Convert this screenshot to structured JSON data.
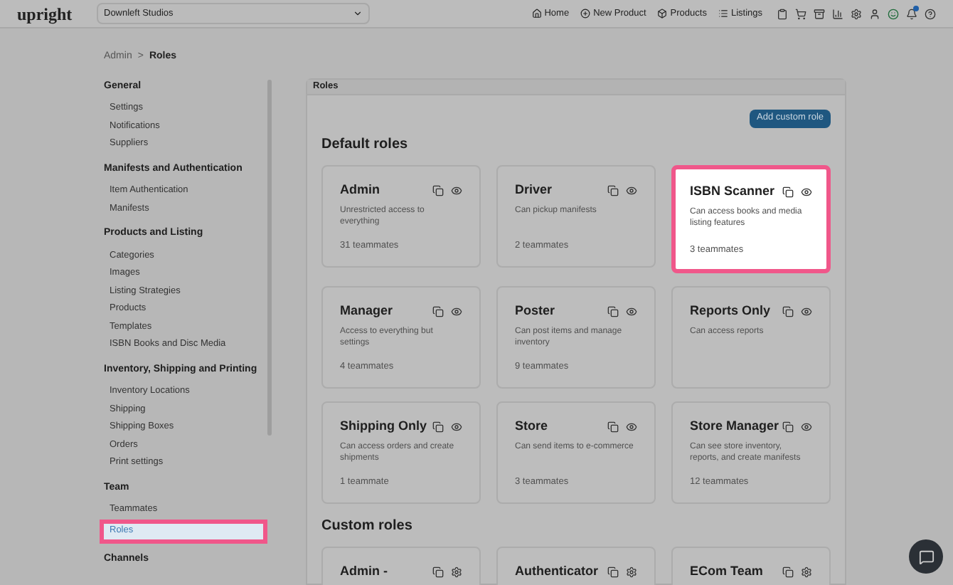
{
  "topbar": {
    "logo": "upright",
    "org_select": "Downleft Studios",
    "nav": [
      {
        "label": "Home"
      },
      {
        "label": "New Product"
      },
      {
        "label": "Products"
      },
      {
        "label": "Listings"
      }
    ],
    "notification_dot": true
  },
  "breadcrumb": {
    "parent": "Admin",
    "separator": ">",
    "current": "Roles"
  },
  "sidebar": [
    {
      "title": "General",
      "items": [
        {
          "label": "Settings",
          "highlighted": false
        },
        {
          "label": "Notifications",
          "highlighted": false
        },
        {
          "label": "Suppliers",
          "highlighted": false
        }
      ]
    },
    {
      "title": "Manifests and Authentication",
      "items": [
        {
          "label": "Item Authentication",
          "highlighted": false
        },
        {
          "label": "Manifests",
          "highlighted": false
        }
      ]
    },
    {
      "title": "Products and Listing",
      "items": [
        {
          "label": "Categories",
          "highlighted": false
        },
        {
          "label": "Images",
          "highlighted": false
        },
        {
          "label": "Listing Strategies",
          "highlighted": false
        },
        {
          "label": "Products",
          "highlighted": false
        },
        {
          "label": "Templates",
          "highlighted": false
        },
        {
          "label": "ISBN Books and Disc Media",
          "highlighted": false
        }
      ]
    },
    {
      "title": "Inventory, Shipping and Printing",
      "items": [
        {
          "label": "Inventory Locations",
          "highlighted": false
        },
        {
          "label": "Shipping",
          "highlighted": false
        },
        {
          "label": "Shipping Boxes",
          "highlighted": false
        },
        {
          "label": "Orders",
          "highlighted": false
        },
        {
          "label": "Print settings",
          "highlighted": false
        }
      ]
    },
    {
      "title": "Team",
      "items": [
        {
          "label": "Teammates",
          "highlighted": false
        },
        {
          "label": "Roles",
          "highlighted": true
        }
      ]
    },
    {
      "title": "Channels"
    }
  ],
  "panel": {
    "title": "Roles",
    "add_button": "Add custom role",
    "groups": [
      {
        "title": "Default roles",
        "kind": "view",
        "roles": [
          {
            "name": "Admin",
            "description": "Unrestricted access to everything",
            "teammates": "31 teammates",
            "highlighted": false
          },
          {
            "name": "Driver",
            "description": "Can pickup manifests",
            "teammates": "2 teammates",
            "highlighted": false
          },
          {
            "name": "ISBN Scanner",
            "description": "Can access books and media listing features",
            "teammates": "3 teammates",
            "highlighted": true
          },
          {
            "name": "Manager",
            "description": "Access to everything but settings",
            "teammates": "4 teammates",
            "highlighted": false
          },
          {
            "name": "Poster",
            "description": "Can post items and manage inventory",
            "teammates": "9 teammates",
            "highlighted": false
          },
          {
            "name": "Reports Only",
            "description": "Can access reports",
            "highlighted": false
          },
          {
            "name": "Shipping Only",
            "description": "Can access orders and create shipments",
            "teammates": "1 teammate",
            "highlighted": false
          },
          {
            "name": "Store",
            "description": "Can send items to e-commerce",
            "teammates": "3 teammates",
            "highlighted": false
          },
          {
            "name": "Store Manager",
            "description": "Can see store inventory, reports, and create manifests",
            "teammates": "12 teammates",
            "highlighted": false
          }
        ]
      },
      {
        "title": "Custom roles",
        "kind": "settings",
        "roles": [
          {
            "name": "Admin -",
            "highlighted": false
          },
          {
            "name": "Authenticator",
            "highlighted": false
          },
          {
            "name": "ECom Team",
            "highlighted": false
          }
        ]
      }
    ]
  }
}
